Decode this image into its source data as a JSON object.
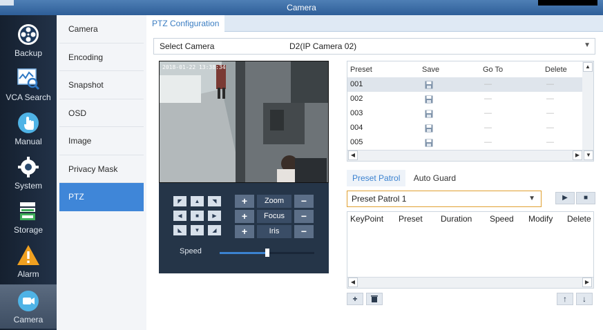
{
  "window": {
    "title": "Camera"
  },
  "nav": [
    {
      "label": "Backup",
      "icon": "backup-reel-icon"
    },
    {
      "label": "VCA Search",
      "icon": "vca-search-icon"
    },
    {
      "label": "Manual",
      "icon": "manual-hand-icon"
    },
    {
      "label": "System",
      "icon": "system-gear-icon"
    },
    {
      "label": "Storage",
      "icon": "storage-icon"
    },
    {
      "label": "Alarm",
      "icon": "alarm-warning-icon"
    },
    {
      "label": "Camera",
      "icon": "camera-icon"
    }
  ],
  "submenu": [
    "Camera",
    "Encoding",
    "Snapshot",
    "OSD",
    "Image",
    "Privacy Mask",
    "PTZ"
  ],
  "tab": {
    "label": "PTZ Configuration"
  },
  "select_camera": {
    "label": "Select Camera",
    "value": "D2(IP Camera 02)"
  },
  "video": {
    "osd_text": "2018-01-22 13:38:34"
  },
  "ptz": {
    "zoom_label": "Zoom",
    "focus_label": "Focus",
    "iris_label": "Iris",
    "speed_label": "Speed",
    "speed_level": 0.5
  },
  "preset_table": {
    "columns": [
      "Preset",
      "Save",
      "Go To",
      "Delete"
    ],
    "rows": [
      "001",
      "002",
      "003",
      "004",
      "005"
    ]
  },
  "patrol_tabs": [
    "Preset Patrol",
    "Auto Guard"
  ],
  "patrol_select": {
    "value": "Preset Patrol 1"
  },
  "keypoint_table": {
    "columns": [
      "KeyPoint",
      "Preset",
      "Duration",
      "Speed",
      "Modify",
      "Delete"
    ]
  },
  "colors": {
    "accent": "#3f86d8",
    "nav_bg": "#1c2a3e",
    "alarm": "#f0a020"
  }
}
